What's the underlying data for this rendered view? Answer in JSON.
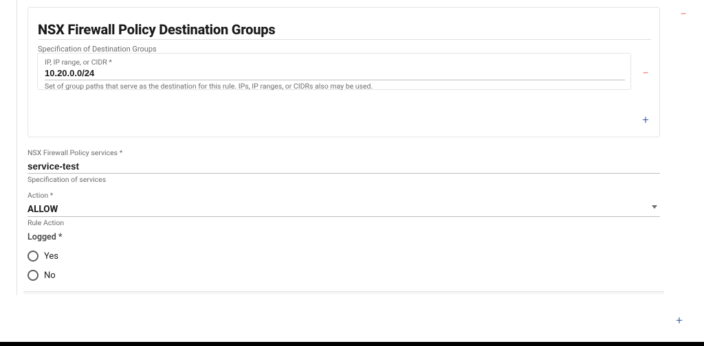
{
  "destination_groups": {
    "title": "NSX Firewall Policy Destination Groups",
    "subtitle": "Specification of Destination Groups",
    "entry": {
      "label": "IP, IP range, or CIDR *",
      "value": "10.20.0.0/24",
      "help": "Set of group paths that serve as the destination for this rule. IPs, IP ranges, or CIDRs also may be used."
    }
  },
  "services": {
    "label": "NSX Firewall Policy services *",
    "value": "service-test",
    "help": "Specification of services"
  },
  "action": {
    "label": "Action *",
    "value": "ALLOW",
    "help": "Rule Action"
  },
  "logged": {
    "label": "Logged *",
    "options": [
      "Yes",
      "No"
    ],
    "selected": null
  },
  "icons": {
    "remove": "−",
    "add": "+"
  }
}
